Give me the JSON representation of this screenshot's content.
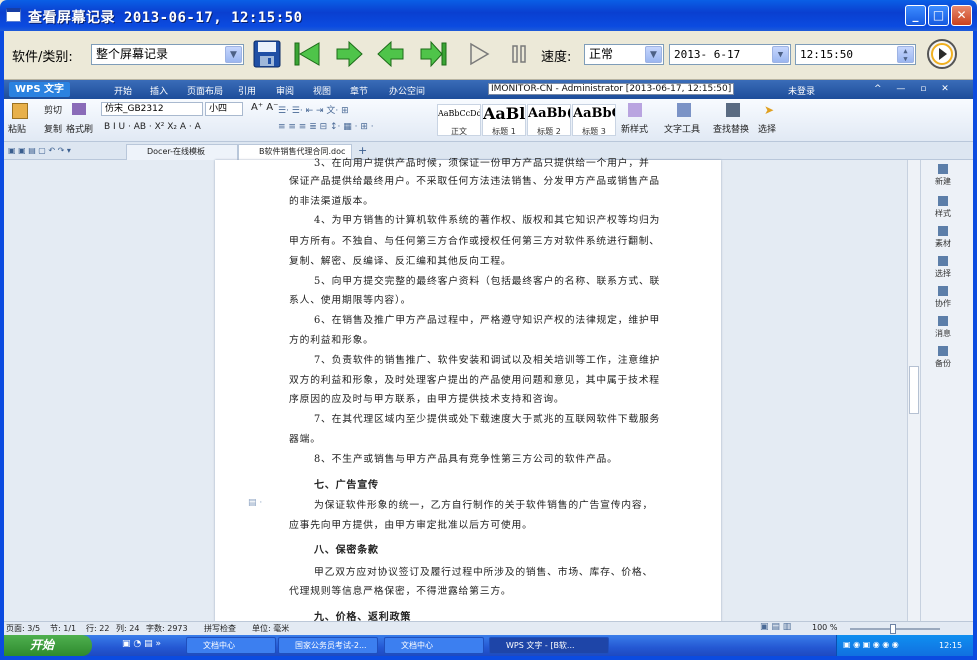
{
  "window": {
    "title": "查看屏幕记录 2013-06-17, 12:15:50"
  },
  "toolbar": {
    "category_label": "软件/类别:",
    "category_value": "整个屏幕记录",
    "speed_label": "速度:",
    "speed_value": "正常",
    "date_value": "2013- 6-17",
    "time_value": "12:15:50"
  },
  "wps": {
    "app_button": "WPS 文字",
    "menu_tabs": [
      "开始",
      "插入",
      "页面布局",
      "引用",
      "审阅",
      "视图",
      "章节",
      "办公空间"
    ],
    "window_title": "IMONITOR-CN - Administrator [2013-06-17, 12:15:50]",
    "not_logged_in": "未登录",
    "ribbon": {
      "paste": "粘贴",
      "cut": "剪切",
      "copy": "复制",
      "format_painter": "格式刷",
      "font_name": "仿宋_GB2312",
      "font_size": "小四",
      "styles": [
        {
          "preview": "AaBbCcDd",
          "name": "正文"
        },
        {
          "preview": "AaBl",
          "name": "标题 1"
        },
        {
          "preview": "AaBb(",
          "name": "标题 2"
        },
        {
          "preview": "AaBbC",
          "name": "标题 3"
        }
      ],
      "new_style": "新样式",
      "text_tools": "文字工具",
      "find_replace": "查找替换",
      "select": "选择"
    },
    "doc_tabs": [
      "Docer-在线模板",
      "B软件销售代理合同.doc"
    ],
    "document": {
      "lines": [
        "3、在向用户提供产品时候，须保证一份甲方产品只提供给一个用户，并",
        "保证产品提供给最终用户。不采取任何方法违法销售、分发甲方产品或销售产品",
        "的非法渠道版本。",
        "4、为甲方销售的计算机软件系统的著作权、版权和其它知识产权等均归为",
        "甲方所有。不独自、与任何第三方合作或授权任何第三方对软件系统进行翻制、",
        "复制、解密、反编译、反汇编和其他反向工程。",
        "5、向甲方提交完整的最终客户资料（包括最终客户的名称、联系方式、联",
        "系人、使用期限等内容）。",
        "6、在销售及推广甲方产品过程中，严格遵守知识产权的法律规定，维护甲",
        "方的利益和形象。",
        "7、负责软件的销售推广、软件安装和调试以及相关培训等工作，注意维护",
        "双方的利益和形象，及时处理客户提出的产品使用问题和意见，其中属于技术程",
        "序原因的应及时与甲方联系，由甲方提供技术支持和咨询。",
        "7、在其代理区域内至少提供或处下载速度大于贰兆的互联网软件下载服务",
        "器端。",
        "8、不生产或销售与甲方产品具有竞争性第三方公司的软件产品。",
        "七、广告宣传",
        "为保证软件形象的统一，乙方自行制作的关于软件销售的广告宣传内容，",
        "应事先向甲方提供，由甲方审定批准以后方可使用。",
        "八、保密条款",
        "甲乙双方应对协议签订及履行过程中所涉及的销售、市场、库存、价格、",
        "代理规则等信息严格保密，不得泄露给第三方。",
        "九、价格、返利政策"
      ]
    },
    "side_panel": [
      "新建",
      "样式",
      "素材",
      "选择",
      "协作",
      "消息",
      "备份"
    ],
    "status": {
      "page": "页面: 3/5",
      "section": "节: 1/1",
      "row": "行: 22",
      "col": "列: 24",
      "words": "字数: 2973",
      "spell": "拼写检查",
      "unit": "单位: 毫米",
      "zoom": "100 %"
    }
  },
  "taskbar": {
    "start": "开始",
    "tasks": [
      "文档中心",
      "国家公务员考试-2...",
      "文档中心",
      "WPS 文字 - [B软..."
    ],
    "clock": "12:15"
  }
}
